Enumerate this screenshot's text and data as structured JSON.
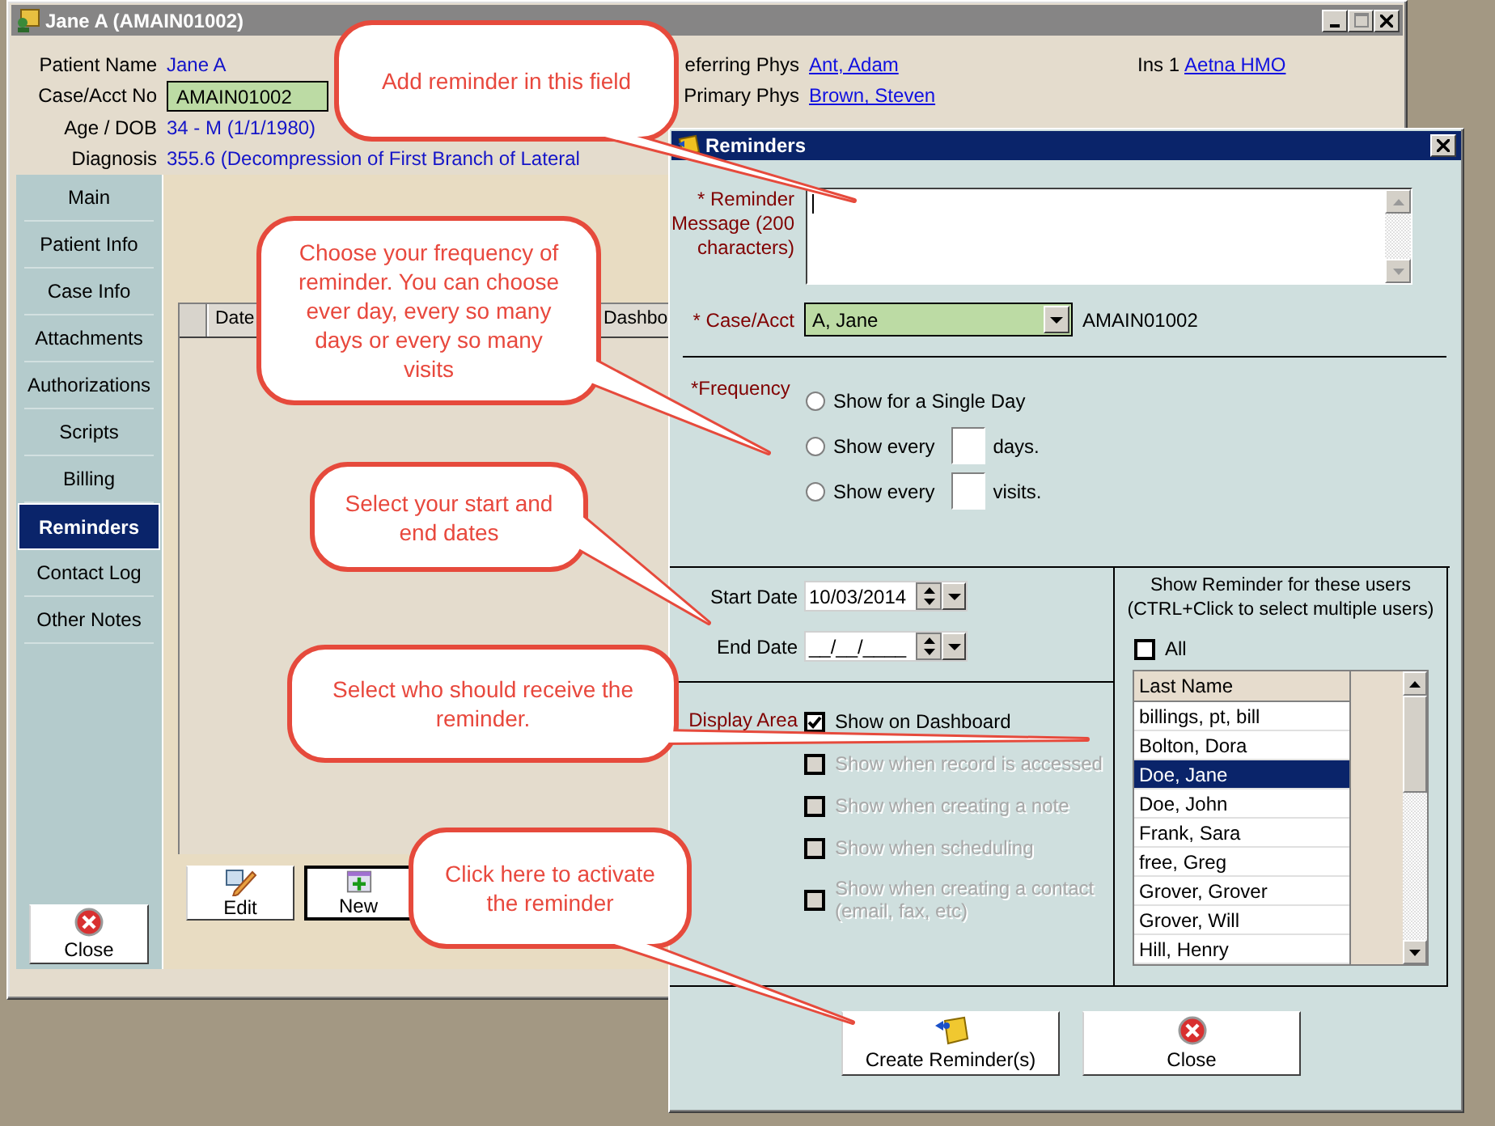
{
  "main_window": {
    "title": "Jane A (AMAIN01002)",
    "fields": [
      {
        "kind": "text",
        "label": "Patient Name",
        "value": "Jane A"
      },
      {
        "kind": "field",
        "label": "Case/Acct No",
        "value": "AMAIN01002"
      },
      {
        "kind": "text",
        "label": "Age / DOB",
        "value": "34 - M (1/1/1980)"
      },
      {
        "kind": "text",
        "label": "Diagnosis",
        "value": "355.6 (Decompression of First Branch of Lateral"
      }
    ],
    "physicians": [
      {
        "label": "eferring Phys",
        "value": "Ant, Adam"
      },
      {
        "label": "Primary Phys",
        "value": "Brown, Steven"
      }
    ],
    "insurance": {
      "label": "Ins 1",
      "value": "Aetna HMO"
    },
    "sidebar": {
      "items": [
        {
          "label": "Main",
          "selected": false
        },
        {
          "label": "Patient Info",
          "selected": false
        },
        {
          "label": "Case Info",
          "selected": false
        },
        {
          "label": "Attachments",
          "selected": false
        },
        {
          "label": "Authorizations",
          "selected": false
        },
        {
          "label": "Scripts",
          "selected": false
        },
        {
          "label": "Billing",
          "selected": false
        },
        {
          "label": "Reminders",
          "selected": true
        },
        {
          "label": "Contact Log",
          "selected": false
        },
        {
          "label": "Other Notes",
          "selected": false
        }
      ],
      "close": "Close"
    },
    "table": {
      "columns": [
        "Date",
        "Dashbo"
      ]
    },
    "buttons": [
      {
        "kind": "edit",
        "label": "Edit"
      },
      {
        "kind": "new",
        "label": "New"
      }
    ]
  },
  "dialog": {
    "title": "Reminders",
    "message": {
      "label": "* Reminder Message (200 characters)"
    },
    "case": {
      "label": "* Case/Acct",
      "value": "A, Jane",
      "account": "AMAIN01002"
    },
    "frequency": {
      "label": "*Frequency",
      "options": [
        {
          "kind": "single",
          "label": "Show for a Single Day",
          "selected": false
        },
        {
          "kind": "interval",
          "label": "Show every",
          "unit": "days.",
          "selected": false
        },
        {
          "kind": "interval",
          "label": "Show every",
          "unit": "visits.",
          "selected": false
        }
      ]
    },
    "start_date": {
      "label": "Start Date",
      "value": "10/03/2014"
    },
    "end_date": {
      "label": "End Date",
      "value": "__/__/____"
    },
    "display_area": {
      "label": "Display Area",
      "options": [
        {
          "label": "Show on Dashboard",
          "checked": true,
          "disabled": false
        },
        {
          "label": "Show when record is accessed",
          "checked": false,
          "disabled": true
        },
        {
          "label": "Show when creating a note",
          "checked": false,
          "disabled": true
        },
        {
          "label": "Show when scheduling",
          "checked": false,
          "disabled": true
        },
        {
          "label": "Show when creating a contact (email, fax, etc)",
          "checked": false,
          "disabled": true
        }
      ]
    },
    "users": {
      "title": "Show Reminder for these users",
      "hint": "(CTRL+Click to select multiple users)",
      "all": {
        "label": "All",
        "checked": false
      },
      "column": "Last Name",
      "rows": [
        {
          "name": "billings, pt, bill",
          "selected": false
        },
        {
          "name": "Bolton, Dora",
          "selected": false
        },
        {
          "name": "Doe, Jane",
          "selected": true
        },
        {
          "name": "Doe, John",
          "selected": false
        },
        {
          "name": "Frank, Sara",
          "selected": false
        },
        {
          "name": "free, Greg",
          "selected": false
        },
        {
          "name": "Grover, Grover",
          "selected": false
        },
        {
          "name": "Grover, Will",
          "selected": false
        },
        {
          "name": "Hill, Henry",
          "selected": false
        }
      ]
    },
    "buttons": [
      {
        "kind": "create",
        "label": "Create Reminder(s)"
      },
      {
        "kind": "close",
        "label": "Close"
      }
    ]
  },
  "callouts": [
    "Add reminder in this field",
    "Choose your frequency of reminder. You can choose ever day, every so many days or every so many visits",
    "Select your start and end dates",
    "Select who should receive the reminder.",
    "Click here to activate the reminder"
  ]
}
